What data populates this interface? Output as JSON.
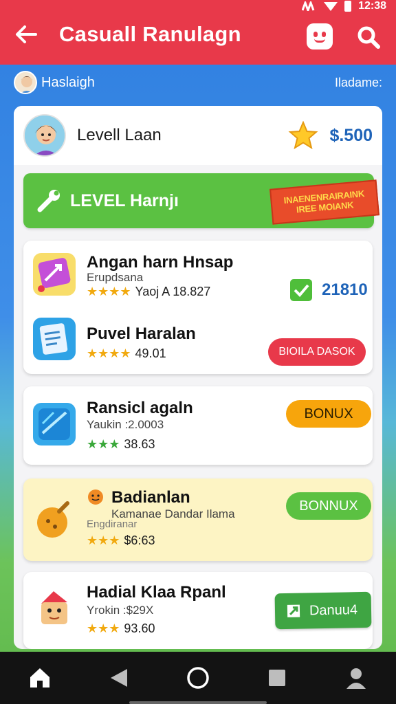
{
  "app_bar": {
    "title": "Casuall Ranulagn",
    "status_icons": [
      "signal-icon",
      "wifi-icon",
      "battery-icon"
    ],
    "status_time": "12:38",
    "back_icon": "arrow-left-icon",
    "actions": [
      "face-icon",
      "search-icon"
    ],
    "color": "#e8394a"
  },
  "user_row": {
    "name": "Haslaigh",
    "right_label": "Iladame:"
  },
  "profile": {
    "name": "Levell Laan",
    "coins": "$.500",
    "star_icon": "star-icon"
  },
  "level_banner": {
    "label": "LEVEL Harnjı",
    "ribbon_line1": "INAENENRAIRAINK",
    "ribbon_line2": "IREE MOIANK"
  },
  "cards": [
    {
      "rows": [
        {
          "title": "Angan harn Hnsap",
          "subtitle": "Erupdsana",
          "stars": "★★★★",
          "rating": "Yaoj A 18.827",
          "right_value": "21810"
        },
        {
          "title": "Puvel Haralan",
          "stars": "★★★★",
          "rating": "49.01",
          "button": "BIOILA DASOK"
        }
      ]
    },
    {
      "title": "Ransicl agaln",
      "subtitle": "Yaukin :2.0003",
      "stars": "★★★",
      "rating": "38.63",
      "button": "BONUX"
    },
    {
      "title": "Badianlan",
      "subtitle": "Kamanae Dandar Ilama",
      "subtitle2": "Engdiranar",
      "stars": "★★★",
      "rating": "$6:63",
      "button": "BONNUX"
    },
    {
      "title": "Hadial Klaa Rpanl",
      "subtitle": "Yrokin :$29X",
      "stars": "★★★",
      "rating": "93.60",
      "button": "Danuu4"
    }
  ],
  "nav": [
    "home-icon",
    "back-triangle-icon",
    "home-circle-icon",
    "recents-square-icon",
    "profile-icon"
  ]
}
